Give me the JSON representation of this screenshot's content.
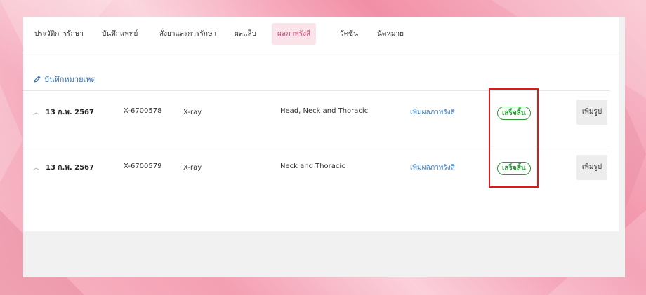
{
  "tabs": [
    {
      "label": "ประวัติการรักษา",
      "active": false
    },
    {
      "label": "บันทึกแพทย์",
      "active": false
    },
    {
      "label": "สั่งยาและการรักษา",
      "active": false
    },
    {
      "label": "ผลแล็บ",
      "active": false
    },
    {
      "label": "ผลภาพรังสี",
      "active": true
    },
    {
      "label": "วัคซีน",
      "active": false
    },
    {
      "label": "นัดหมาย",
      "active": false
    }
  ],
  "note": {
    "icon": "pencil-icon",
    "label": "บันทึกหมายเหตุ"
  },
  "rows": [
    {
      "date": "13 ก.พ. 2567",
      "accession": "X-6700578",
      "modality": "X-ray",
      "body_part": "Head, Neck and Thoracic",
      "add_result_link": "เพิ่มผลภาพรังสี",
      "status": "เสร็จสิ้น",
      "add_image_button": "เพิ่มรูป"
    },
    {
      "date": "13 ก.พ. 2567",
      "accession": "X-6700579",
      "modality": "X-ray",
      "body_part": "Neck and Thoracic",
      "add_result_link": "เพิ่มผลภาพรังสี",
      "status": "เสร็จสิ้น",
      "add_image_button": "เพิ่มรูป"
    }
  ],
  "colors": {
    "accent": "#d0457a",
    "status_green": "#2e9a3c",
    "link": "#3a7fd0",
    "highlight_box": "#e01818"
  }
}
